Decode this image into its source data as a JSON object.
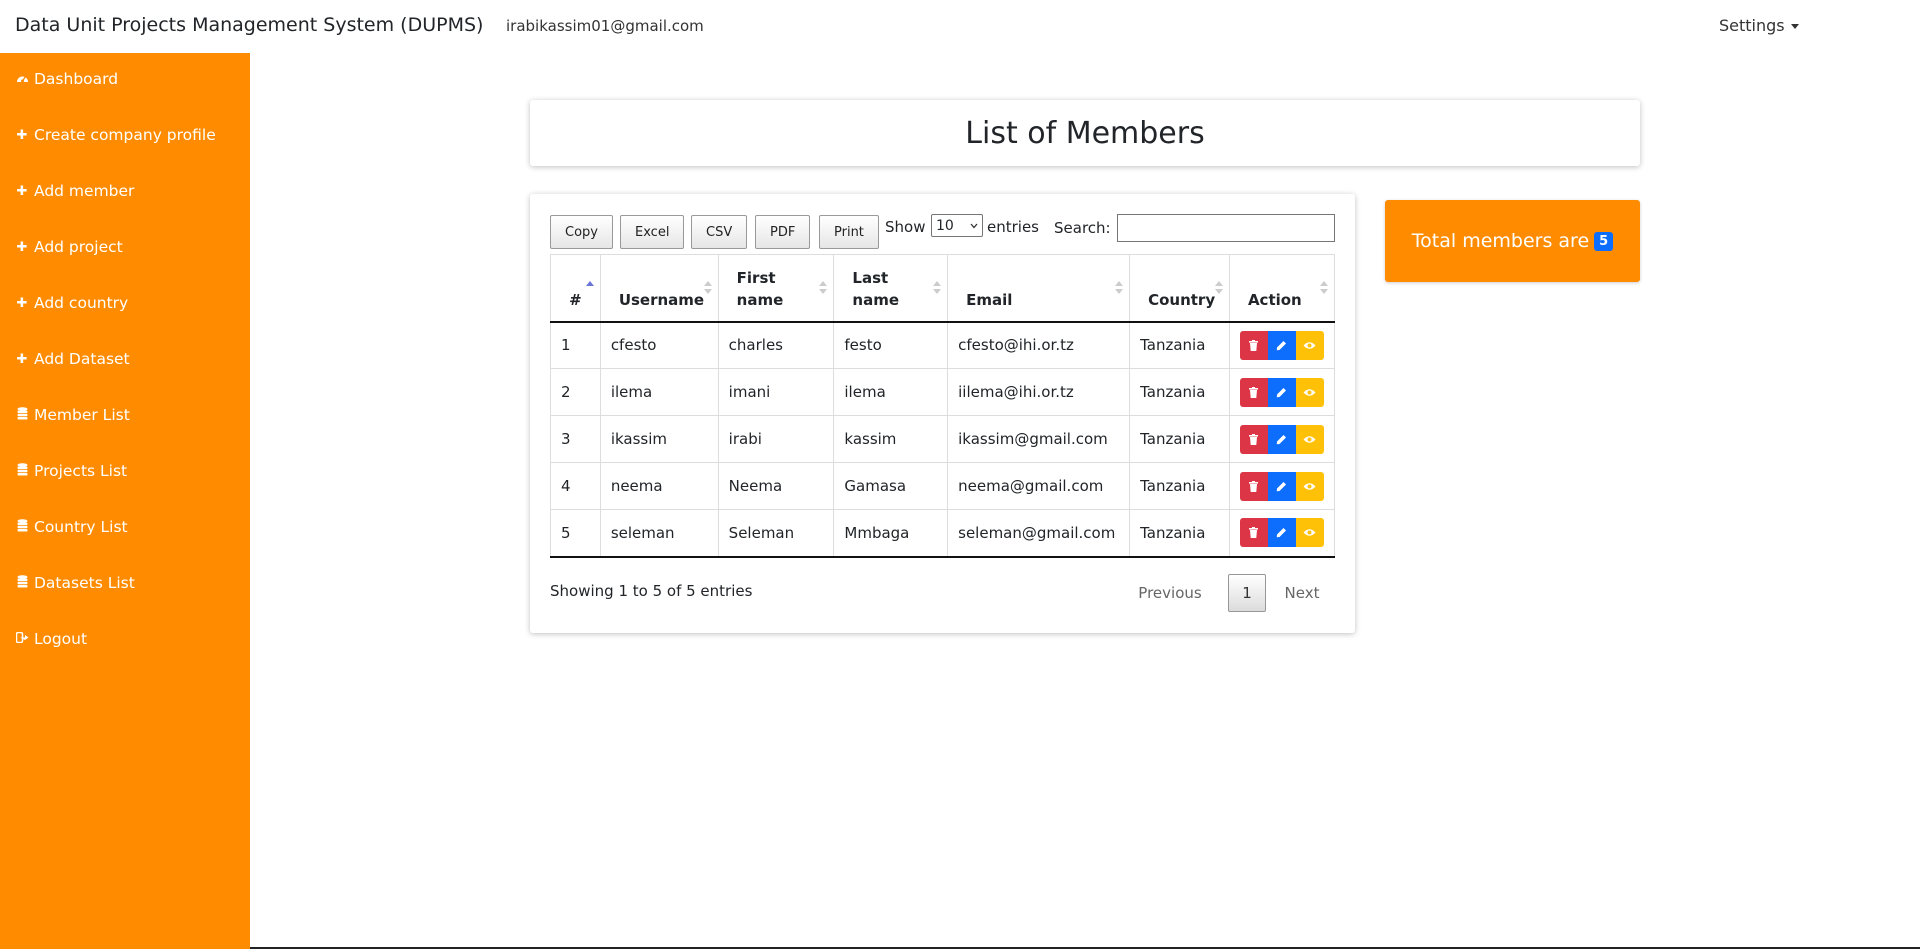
{
  "header": {
    "brand": "Data Unit Projects Management System (DUPMS)",
    "user_email": "irabikassim01@gmail.com",
    "settings_label": "Settings"
  },
  "sidebar": {
    "items": [
      {
        "label": "Dashboard",
        "icon": "dashboard-icon"
      },
      {
        "label": "Create company profile",
        "icon": "plus-icon"
      },
      {
        "label": "Add member",
        "icon": "plus-icon"
      },
      {
        "label": "Add project",
        "icon": "plus-icon"
      },
      {
        "label": "Add country",
        "icon": "plus-icon"
      },
      {
        "label": "Add Dataset",
        "icon": "plus-icon"
      },
      {
        "label": "Member List",
        "icon": "database-icon"
      },
      {
        "label": "Projects List",
        "icon": "database-icon"
      },
      {
        "label": "Country List",
        "icon": "database-icon"
      },
      {
        "label": "Datasets List",
        "icon": "database-icon"
      },
      {
        "label": "Logout",
        "icon": "logout-icon"
      }
    ]
  },
  "page": {
    "title": "List of Members"
  },
  "toolbar": {
    "copy": "Copy",
    "excel": "Excel",
    "csv": "CSV",
    "pdf": "PDF",
    "print": "Print",
    "show_label": "Show",
    "entries_value": "10",
    "entries_label": "entries",
    "search_label": "Search:",
    "search_value": ""
  },
  "table": {
    "headers": {
      "num": "#",
      "username": "Username",
      "first_name_1": "First",
      "first_name_2": "name",
      "last_name_1": "Last",
      "last_name_2": "name",
      "email": "Email",
      "country": "Country",
      "action": "Action"
    },
    "rows": [
      {
        "num": "1",
        "username": "cfesto",
        "first": "charles",
        "last": "festo",
        "email": "cfesto@ihi.or.tz",
        "country": "Tanzania"
      },
      {
        "num": "2",
        "username": "ilema",
        "first": "imani",
        "last": "ilema",
        "email": "iilema@ihi.or.tz",
        "country": "Tanzania"
      },
      {
        "num": "3",
        "username": "ikassim",
        "first": "irabi",
        "last": "kassim",
        "email": "ikassim@gmail.com",
        "country": "Tanzania"
      },
      {
        "num": "4",
        "username": "neema",
        "first": "Neema",
        "last": "Gamasa",
        "email": "neema@gmail.com",
        "country": "Tanzania"
      },
      {
        "num": "5",
        "username": "seleman",
        "first": "Seleman",
        "last": "Mmbaga",
        "email": "seleman@gmail.com",
        "country": "Tanzania"
      }
    ]
  },
  "footer": {
    "info": "Showing 1 to 5 of 5 entries",
    "previous": "Previous",
    "page": "1",
    "next": "Next"
  },
  "summary": {
    "label": "Total members are",
    "count": "5"
  },
  "colors": {
    "sidebar": "#ff8c00",
    "delete": "#dc3545",
    "edit": "#0d6efd",
    "view": "#ffc107",
    "badge": "#0d6efd"
  }
}
